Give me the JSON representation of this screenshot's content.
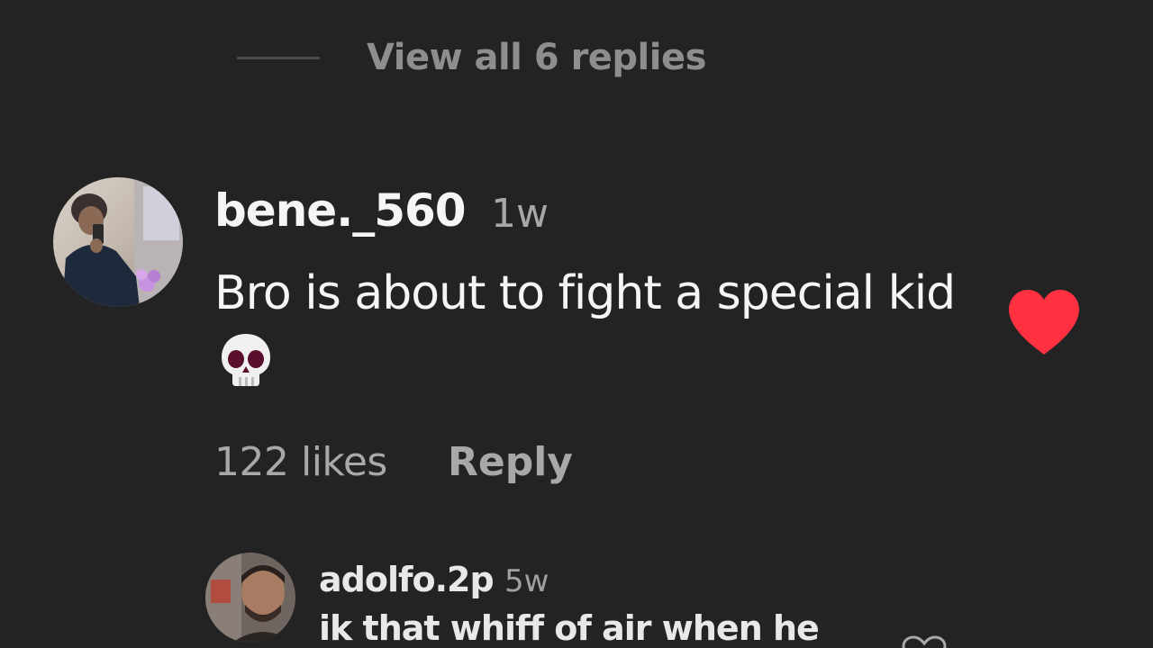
{
  "replies_toggle": {
    "label": "View all 6 replies"
  },
  "comment": {
    "username": "bene._560",
    "time": "1w",
    "text": "Bro is about to fight a special kid",
    "emoji": "skull-emoji",
    "likes": "122 likes",
    "reply_label": "Reply",
    "liked": true,
    "heart_color": "#ff3040"
  },
  "reply_comment": {
    "username": "adolfo.2p",
    "time": "5w",
    "text": "ik that whiff of air when he"
  },
  "colors": {
    "background": "#232323",
    "primary_text": "#f5f5f5",
    "secondary_text": "#a8a8a8",
    "like_red": "#ff3040"
  }
}
